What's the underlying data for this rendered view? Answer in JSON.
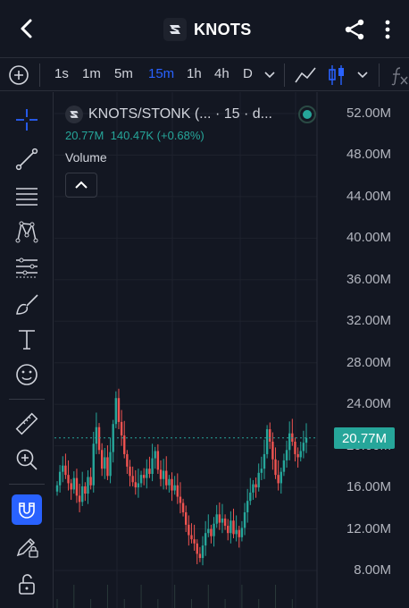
{
  "header": {
    "title": "KNOTS"
  },
  "toolbar": {
    "timeframes": [
      "1s",
      "1m",
      "5m",
      "15m",
      "1h",
      "4h",
      "D"
    ],
    "active_timeframe": "15m"
  },
  "legend": {
    "symbol": "KNOTS/STONK (... · 15 · d...",
    "last_value": "20.77M",
    "change": "140.47K (+0.68%)",
    "indicator": "Volume"
  },
  "price_scale": {
    "ticks": [
      "52.00M",
      "48.00M",
      "44.00M",
      "40.00M",
      "36.00M",
      "32.00M",
      "28.00M",
      "24.00M",
      "20.00M",
      "16.00M",
      "12.00M",
      "8.00M"
    ],
    "last_price_label": "20.77M"
  },
  "colors": {
    "background": "#131722",
    "accent": "#2962ff",
    "up": "#26a69a",
    "down": "#ef5350"
  },
  "chart_data": {
    "type": "candlestick",
    "xlabel": "",
    "ylabel": "",
    "ylim": [
      6.5,
      54
    ],
    "y_unit": "M",
    "last_price": 20.77,
    "close_series": [
      16.2,
      17.5,
      18.1,
      17.2,
      16.4,
      15.8,
      16.9,
      15.2,
      14.6,
      16.1,
      15.4,
      17.0,
      16.2,
      20.2,
      21.8,
      19.6,
      17.8,
      18.9,
      17.1,
      19.4,
      22.1,
      24.6,
      22.3,
      21.0,
      19.2,
      18.0,
      17.1,
      16.5,
      16.0,
      16.4,
      17.2,
      16.9,
      17.8,
      17.3,
      18.8,
      19.5,
      17.7,
      16.8,
      17.6,
      16.2,
      16.8,
      15.7,
      16.2,
      15.1,
      14.5,
      13.6,
      12.4,
      11.4,
      11.0,
      10.6,
      9.6,
      9.2,
      10.4,
      11.6,
      12.0,
      11.3,
      12.5,
      13.4,
      12.6,
      13.0,
      12.3,
      11.6,
      12.8,
      11.5,
      11.9,
      11.2,
      12.1,
      13.6,
      14.7,
      15.5,
      16.3,
      16.0,
      17.4,
      17.8,
      19.2,
      21.6,
      20.4,
      18.7,
      17.2,
      16.4,
      17.5,
      18.6,
      19.6,
      21.2,
      20.4,
      19.2,
      18.9,
      19.5,
      20.3,
      20.77
    ]
  }
}
